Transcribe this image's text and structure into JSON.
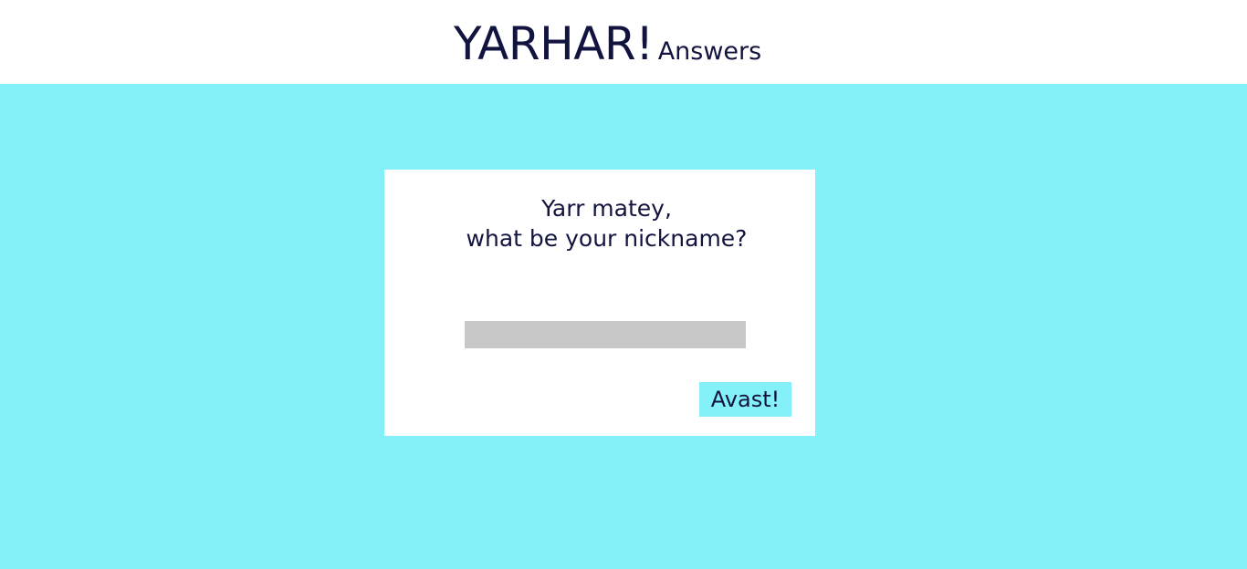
{
  "header": {
    "logo_main": "YARHAR!",
    "logo_sub": "Answers"
  },
  "card": {
    "prompt_line1": "Yarr matey,",
    "prompt_line2": "what be your nickname?",
    "nickname_value": "",
    "nickname_placeholder": "",
    "submit_label": "Avast!"
  },
  "colors": {
    "background": "#84f0f7",
    "text": "#121440",
    "input": "#c8c8c8"
  }
}
